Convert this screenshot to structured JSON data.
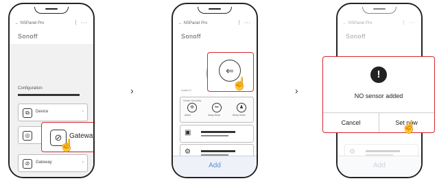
{
  "phones": {
    "screen_title": "← NSPanel Pro",
    "menu_dots": "⋮ ···",
    "brand": "Sonoff"
  },
  "step_arrow": "›",
  "phone1": {
    "config_label": "Configuration",
    "rows": [
      {
        "icon": "⧉",
        "label": "Device"
      },
      {
        "icon": "◎",
        "label": ""
      },
      {
        "icon": "⊘",
        "label": "Gateway"
      }
    ],
    "popup": {
      "icon": "⊘",
      "label": "Gateway"
    }
  },
  "phone2": {
    "section_label": "Added 0",
    "panel_label": "Smart Security",
    "minis": [
      {
        "icon": "⊛",
        "label": "Alarm"
      },
      {
        "icon": "⇐",
        "label": "Away Mode"
      },
      {
        "icon": "♟",
        "label": "Sleep Mode"
      }
    ],
    "rows": [
      {
        "icon": "▣"
      },
      {
        "icon": "⚙"
      }
    ],
    "add_label": "Add"
  },
  "phone3": {
    "add_label": "Add"
  },
  "dialog": {
    "icon": "!",
    "message": "NO sensor added",
    "cancel": "Cancel",
    "confirm": "Set now"
  },
  "colors": {
    "accent": "#d6262d",
    "link": "#5a8ed8"
  }
}
